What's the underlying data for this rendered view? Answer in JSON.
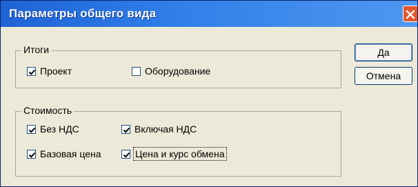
{
  "window": {
    "title": "Параметры общего вида"
  },
  "icons": {
    "close": "close-icon",
    "check": "check-icon"
  },
  "colors": {
    "titlebar": "#2f7ee8",
    "close_button": "#e2552a",
    "dialog_bg": "#ece9d8"
  },
  "groups": {
    "totals": {
      "legend": "Итоги",
      "items": [
        {
          "label": "Проект",
          "checked": true
        },
        {
          "label": "Оборудование",
          "checked": false
        }
      ]
    },
    "cost": {
      "legend": "Стоимость",
      "items": [
        {
          "label": "Без НДС",
          "checked": true
        },
        {
          "label": "Включая НДС",
          "checked": true
        },
        {
          "label": "Базовая цена",
          "checked": true
        },
        {
          "label": "Цена и курс обмена",
          "checked": true
        }
      ]
    }
  },
  "buttons": {
    "ok": "Да",
    "cancel": "Отмена"
  }
}
